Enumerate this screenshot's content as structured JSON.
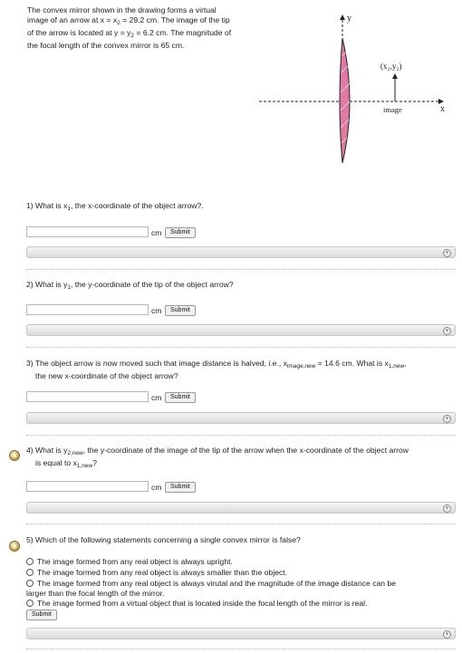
{
  "intro": {
    "line1": "The convex mirror shown in the drawing forms a virtual",
    "line2a": "image of an arrow at x = x",
    "line2b": "2",
    "line2c": " = 29.2 cm. The image of the tip",
    "line3a": "of the arrow is located at y = y",
    "line3b": "2",
    "line3c": " = 6.2 cm. The magnitude of",
    "line4": "the focal length of the convex mirror is 65 cm."
  },
  "diagram": {
    "y_label": "y",
    "x_label": "x",
    "point_label": "(x₂,y₂)",
    "image_label": "image"
  },
  "q1": {
    "a": "1) What is x",
    "b": "1",
    "c": ", the x-coordinate of the object arrow?.",
    "unit": "cm",
    "submit": "Submit"
  },
  "q2": {
    "a": "2) What is y",
    "b": "1",
    "c": ", the y-coordinate of the tip of the object arrow?",
    "unit": "cm",
    "submit": "Submit"
  },
  "q3": {
    "a": "3) The object arrow is now moved such that image distance is halved, ",
    "ie": "i.e.",
    "b": ", x",
    "sub1": "image,new",
    "c": " = 14.6 cm. What is x",
    "sub2": "1,new",
    "d": ",",
    "line2": "the new x-coordinate of the object arrow?",
    "unit": "cm",
    "submit": "Submit"
  },
  "q4": {
    "a": "4) What is y",
    "sub1": "2,new",
    "b": ", the y-coordinate of the image of the tip of the arrow when the x-coordinate of the object arrow",
    "c": "is equal to x",
    "sub2": "1,new",
    "d": "?",
    "unit": "cm",
    "submit": "Submit"
  },
  "q5": {
    "text": "5) Which of the following statements concerning a single convex mirror is false?",
    "options": [
      "The image formed from any real object is always upright.",
      "The image formed from any real object is always smaller than the object.",
      "The image formed from any real object is always virutal and the magnitude of the image distance can be",
      "The image formed from a virtual object that is located inside the focal length of the mirror is real."
    ],
    "option3_line2": "larger than the focal length of the mirror.",
    "submit": "Submit"
  },
  "expand_icon": "plus-circle-icon"
}
